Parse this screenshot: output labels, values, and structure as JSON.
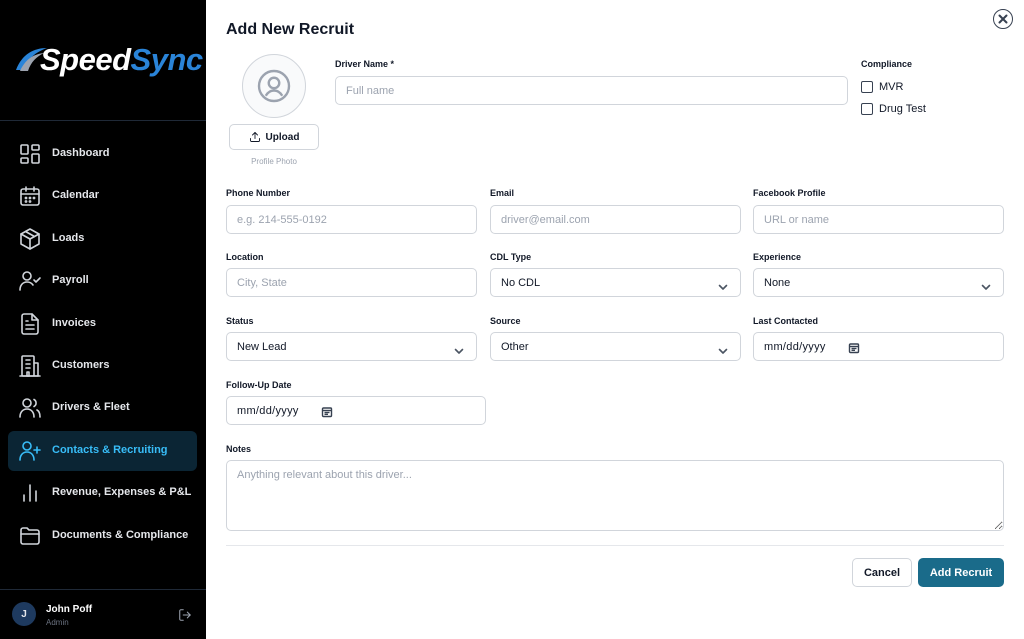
{
  "brand": {
    "name_part1": "Speed",
    "name_part2": "Sync",
    "accent_color": "#2a84d8"
  },
  "sidebar": {
    "items": [
      {
        "label": "Dashboard",
        "icon": "dashboard-icon",
        "active": false
      },
      {
        "label": "Calendar",
        "icon": "calendar-icon",
        "active": false
      },
      {
        "label": "Loads",
        "icon": "box-icon",
        "active": false
      },
      {
        "label": "Payroll",
        "icon": "user-check-icon",
        "active": false
      },
      {
        "label": "Invoices",
        "icon": "document-icon",
        "active": false
      },
      {
        "label": "Customers",
        "icon": "building-icon",
        "active": false
      },
      {
        "label": "Drivers & Fleet",
        "icon": "users-icon",
        "active": false
      },
      {
        "label": "Contacts & Recruiting",
        "icon": "user-plus-icon",
        "active": true
      },
      {
        "label": "Revenue, Expenses & P&L",
        "icon": "bar-chart-icon",
        "active": false
      },
      {
        "label": "Documents & Compliance",
        "icon": "folder-icon",
        "active": false
      }
    ],
    "active_color": "#38bdf8"
  },
  "user": {
    "initial": "J",
    "name": "John Poff",
    "role": "Admin"
  },
  "modal": {
    "title": "Add New Recruit",
    "photo": {
      "upload_label": "Upload",
      "caption": "Profile Photo"
    },
    "driver_name": {
      "label": "Driver Name *",
      "placeholder": "Full name"
    },
    "compliance": {
      "label": "Compliance",
      "options": [
        {
          "label": "MVR",
          "checked": false
        },
        {
          "label": "Drug Test",
          "checked": false
        }
      ]
    },
    "phone": {
      "label": "Phone Number",
      "placeholder": "e.g. 214-555-0192"
    },
    "email": {
      "label": "Email",
      "placeholder": "driver@email.com"
    },
    "facebook": {
      "label": "Facebook Profile",
      "placeholder": "URL or name"
    },
    "location": {
      "label": "Location",
      "placeholder": "City, State"
    },
    "cdl_type": {
      "label": "CDL Type",
      "value": "No CDL"
    },
    "experience": {
      "label": "Experience",
      "value": "None"
    },
    "status": {
      "label": "Status",
      "value": "New Lead"
    },
    "source": {
      "label": "Source",
      "value": "Other"
    },
    "last_contacted": {
      "label": "Last Contacted",
      "value": "mm/dd/yyyy"
    },
    "follow_up": {
      "label": "Follow-Up Date",
      "value": "mm/dd/yyyy"
    },
    "notes": {
      "label": "Notes",
      "placeholder": "Anything relevant about this driver..."
    },
    "buttons": {
      "cancel": "Cancel",
      "add": "Add Recruit"
    },
    "primary_color": "#1a6b8a"
  }
}
